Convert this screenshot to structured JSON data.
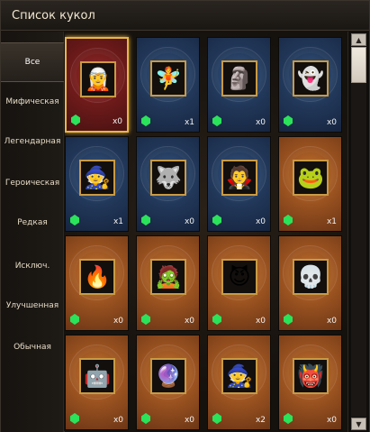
{
  "title": "Список кукол",
  "sidebar": [
    {
      "label": "Все",
      "active": true
    },
    {
      "label": "Мифическая"
    },
    {
      "label": "Легендарная"
    },
    {
      "label": "Героическая"
    },
    {
      "label": "Редкая"
    },
    {
      "label": "Исключ."
    },
    {
      "label": "Улучшенная"
    },
    {
      "label": "Обычная"
    }
  ],
  "cards": [
    {
      "rarity": "red",
      "icon": "knight-portrait",
      "glyph": "🧝",
      "count": "x0",
      "selected": true
    },
    {
      "rarity": "blue",
      "icon": "ice-maiden-portrait",
      "glyph": "🧚",
      "count": "x1"
    },
    {
      "rarity": "blue",
      "icon": "stone-golem-portrait",
      "glyph": "🗿",
      "count": "x0"
    },
    {
      "rarity": "blue",
      "icon": "ice-spirit-portrait",
      "glyph": "👻",
      "count": "x0"
    },
    {
      "rarity": "blue",
      "icon": "white-haired-hero-portrait",
      "glyph": "🧙",
      "count": "x1"
    },
    {
      "rarity": "blue",
      "icon": "beast-warrior-portrait",
      "glyph": "🐺",
      "count": "x0"
    },
    {
      "rarity": "blue",
      "icon": "red-sorceress-portrait",
      "glyph": "🧛",
      "count": "x0"
    },
    {
      "rarity": "orange",
      "icon": "frog-portrait",
      "glyph": "🐸",
      "count": "x1"
    },
    {
      "rarity": "orange",
      "icon": "fire-elemental-portrait",
      "glyph": "🔥",
      "count": "x0"
    },
    {
      "rarity": "orange",
      "icon": "ice-troll-portrait",
      "glyph": "🧟",
      "count": "x0"
    },
    {
      "rarity": "orange",
      "icon": "red-demon-portrait",
      "glyph": "😈",
      "count": "x0"
    },
    {
      "rarity": "orange",
      "icon": "bone-creature-portrait",
      "glyph": "💀",
      "count": "x0"
    },
    {
      "rarity": "orange",
      "icon": "armored-knight-portrait",
      "glyph": "🤖",
      "count": "x0"
    },
    {
      "rarity": "orange",
      "icon": "crystal-orb-portrait",
      "glyph": "🔮",
      "count": "x0"
    },
    {
      "rarity": "orange",
      "icon": "dark-mage-portrait",
      "glyph": "🧙",
      "count": "x2"
    },
    {
      "rarity": "orange",
      "icon": "red-imp-portrait",
      "glyph": "👹",
      "count": "x0"
    }
  ],
  "scroll": {
    "up_icon": "▲",
    "down_icon": "▼"
  }
}
